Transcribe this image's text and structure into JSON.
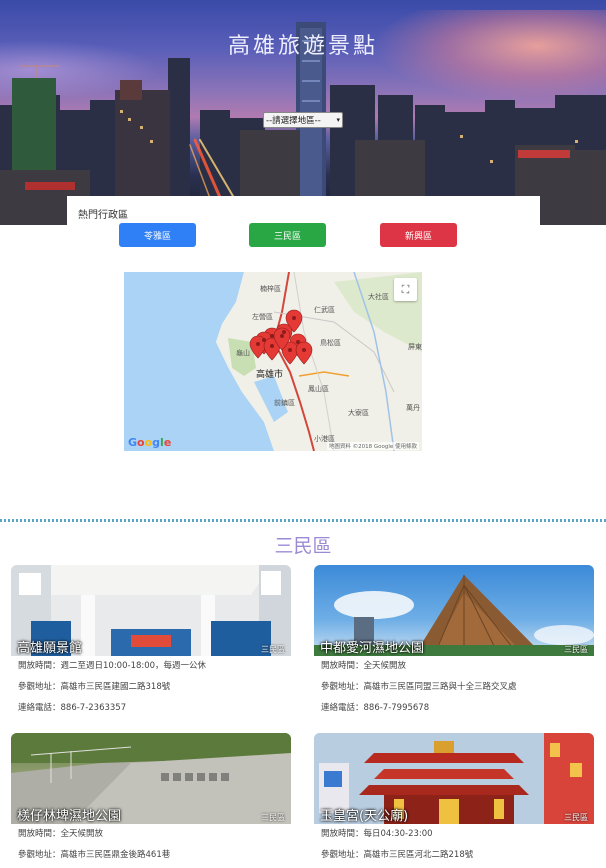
{
  "header": {
    "title": "高雄旅遊景點",
    "select_value": "--請選擇地區--"
  },
  "hot": {
    "title": "熱門行政區",
    "buttons": [
      {
        "label": "苓雅區",
        "color": "#2f7ff6"
      },
      {
        "label": "三民區",
        "color": "#29a745"
      },
      {
        "label": "新興區",
        "color": "#dd3545"
      }
    ]
  },
  "map": {
    "labels": {
      "city": "高雄市",
      "zuoying": "左營區",
      "renwu": "仁武區",
      "dashe": "大社區",
      "niaosong": "鳥松區",
      "pingdong": "屏東",
      "fengshan": "鳳山區",
      "qianzhen": "前鎮區",
      "daliao": "大寮區",
      "xiaogang": "小港區",
      "nanzi": "楠梓區",
      "guishan": "龜山",
      "wanwan": "萬丹"
    },
    "google": "Google",
    "credit": "地圖資料 ©2018 Google 使用條款",
    "fullscreen_icon": "fullscreen-icon",
    "marker_count": 10
  },
  "section": {
    "title": "三民區"
  },
  "cards": [
    {
      "name": "高雄願景館",
      "district": "三民區",
      "open": "開放時間：週二至週日10:00-18:00，每週一公休",
      "address": "參觀地址：高雄市三民區建國二路318號",
      "phone": "連絡電話：886-7-2363357"
    },
    {
      "name": "中都愛河濕地公園",
      "district": "三民區",
      "open": "開放時間：全天候開放",
      "address": "參觀地址：高雄市三民區同盟三路與十全三路交叉處",
      "phone": "連絡電話：886-7-7995678"
    },
    {
      "name": "檨仔林埤濕地公園",
      "district": "三民區",
      "open": "開放時間：全天候開放",
      "address": "參觀地址：高雄市三民區鼎金後路461巷"
    },
    {
      "name": "玉皇宮(天公廟)",
      "district": "三民區",
      "open": "開放時間：每日04:30-23:00",
      "address": "參觀地址：高雄市三民區河北二路218號"
    }
  ]
}
